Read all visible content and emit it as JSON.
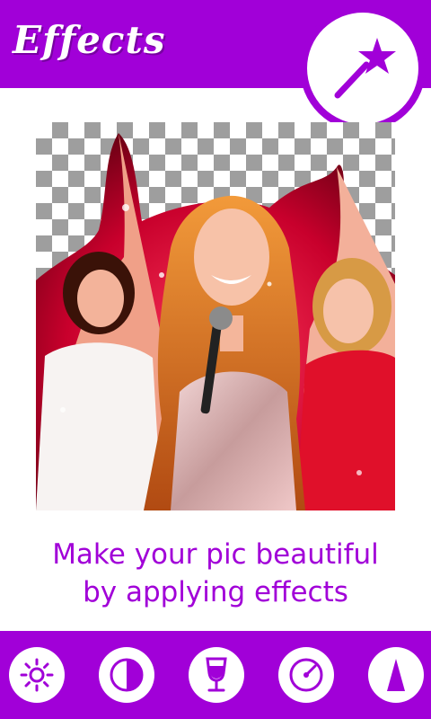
{
  "header": {
    "title": "Effects"
  },
  "magic_button": {
    "icon": "magic-wand-icon"
  },
  "caption": {
    "line1": "Make your pic beautiful",
    "line2": "by applying effects"
  },
  "toolbar": {
    "tools": [
      {
        "icon": "brightness-icon"
      },
      {
        "icon": "contrast-icon"
      },
      {
        "icon": "glass-icon"
      },
      {
        "icon": "gauge-icon"
      },
      {
        "icon": "triangle-icon"
      }
    ]
  },
  "colors": {
    "accent": "#a100d8",
    "background": "#ffffff"
  }
}
